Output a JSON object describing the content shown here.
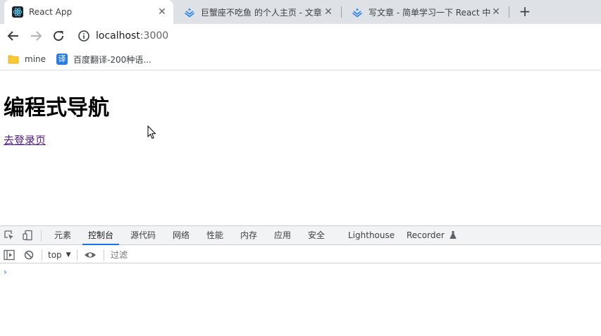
{
  "browser": {
    "tabs": [
      {
        "title": "React App",
        "active": true,
        "favicon": "react-icon"
      },
      {
        "title": "巨蟹座不吃鱼 的个人主页 - 文章",
        "active": false,
        "favicon": "juejin-icon"
      },
      {
        "title": "写文章 - 简单学习一下 React 中的",
        "active": false,
        "favicon": "juejin-icon"
      }
    ],
    "close_glyph": "✕",
    "new_tab_glyph": "+",
    "url_host": "localhost",
    "url_port": ":3000",
    "bookmarks": [
      {
        "label": "mine",
        "icon": "folder-icon"
      },
      {
        "label": "百度翻译-200种语...",
        "icon": "translate-icon",
        "icon_text": "译"
      }
    ]
  },
  "page": {
    "heading": "编程式导航",
    "link": "去登录页"
  },
  "devtools": {
    "tabs": [
      "元素",
      "控制台",
      "源代码",
      "网络",
      "性能",
      "内存",
      "应用",
      "安全",
      "Lighthouse",
      "Recorder"
    ],
    "active_tab": "控制台",
    "context": "top",
    "filter_placeholder": "过滤",
    "prompt": "›"
  },
  "colors": {
    "tabstrip": "#dee1e6",
    "accent": "#1a73e8",
    "link_visited": "#551a8b",
    "juejin": "#1e80ff"
  }
}
